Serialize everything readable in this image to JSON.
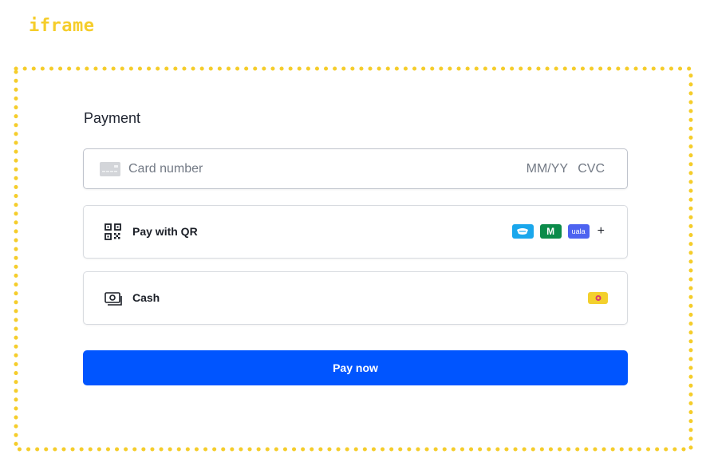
{
  "frame_label": "iframe",
  "payment": {
    "title": "Payment",
    "card": {
      "placeholder": "Card number",
      "expiry_placeholder": "MM/YY",
      "cvc_placeholder": "CVC"
    },
    "methods": [
      {
        "label": "Pay with QR",
        "icon": "qr-code-icon",
        "badges": [
          "wallet-logo",
          "mercadopago-logo",
          "uala-logo"
        ],
        "badge_texts": [
          "",
          "M",
          "uala"
        ],
        "more": "+"
      },
      {
        "label": "Cash",
        "icon": "cash-icon",
        "badges": [
          "cash-network-logo"
        ]
      }
    ],
    "submit_label": "Pay now"
  },
  "colors": {
    "accent": "#0055ff",
    "frame_border": "#f5cd2b"
  }
}
